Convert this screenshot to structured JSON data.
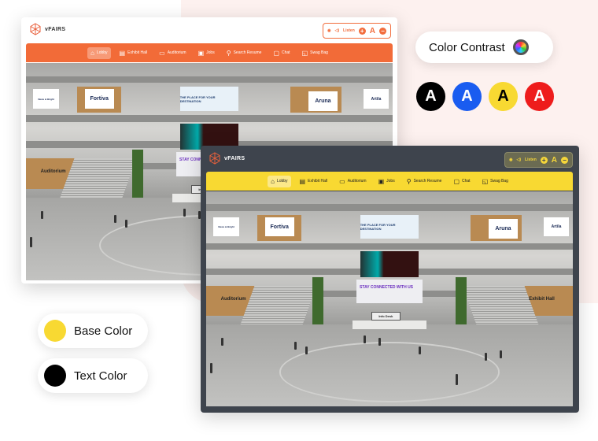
{
  "brand": "vFAIRS",
  "accessibility": {
    "listen": "Listen",
    "font_letter": "A",
    "increase": "+",
    "decrease": "−"
  },
  "nav": [
    {
      "label": "Lobby",
      "icon": "home-icon",
      "glyph": "⌂",
      "active": true
    },
    {
      "label": "Exhibit Hall",
      "icon": "store-icon",
      "glyph": "▤"
    },
    {
      "label": "Auditorium",
      "icon": "laptop-icon",
      "glyph": "▭"
    },
    {
      "label": "Jobs",
      "icon": "briefcase-icon",
      "glyph": "▣"
    },
    {
      "label": "Search Resume",
      "icon": "search-icon",
      "glyph": "⚲"
    },
    {
      "label": "Chat",
      "icon": "chat-icon",
      "glyph": "▢"
    },
    {
      "label": "Swag Bag",
      "icon": "bag-icon",
      "glyph": "◱"
    }
  ],
  "scene": {
    "sponsors": [
      "News & Bright",
      "Fortiva",
      "Aruna",
      "Artila"
    ],
    "top_screen": "THE PLACE FOR YOUR DESTINATION",
    "banner": "STAY CONNECTED WITH US",
    "left_hall": "Auditorium",
    "right_hall": "Exhibit Hall",
    "desk": "Info Desk"
  },
  "themes": {
    "default": {
      "base": "#f26b38",
      "text": "#ffffff"
    },
    "high_contrast": {
      "base": "#f8d932",
      "text": "#000000",
      "frame": "#3e444d"
    }
  },
  "color_contrast": {
    "label": "Color Contrast",
    "options": [
      {
        "letter": "A",
        "color": "#000000"
      },
      {
        "letter": "A",
        "color": "#1a5cf0"
      },
      {
        "letter": "A",
        "color": "#f8d932",
        "text": "#000000"
      },
      {
        "letter": "A",
        "color": "#ee1c1c"
      }
    ]
  },
  "base_color": {
    "label": "Base Color",
    "color": "#f8d932"
  },
  "text_color": {
    "label": "Text Color",
    "color": "#000000"
  }
}
